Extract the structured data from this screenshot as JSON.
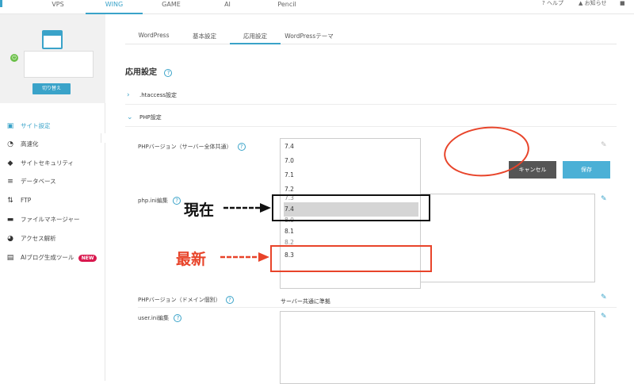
{
  "topnav": {
    "tabs": [
      "VPS",
      "WING",
      "GAME",
      "AI",
      "Pencil"
    ],
    "active_tab": "WING",
    "help_label": "ヘルプ",
    "notice_label": "お知らせ",
    "accent_color": "#3aa3c9"
  },
  "sidebar": {
    "switch_label": "切り替え",
    "items": [
      {
        "label": "サイト設定",
        "icon": "site-settings-icon",
        "active": true
      },
      {
        "label": "高速化",
        "icon": "speed-icon"
      },
      {
        "label": "サイトセキュリティ",
        "icon": "shield-icon"
      },
      {
        "label": "データベース",
        "icon": "database-icon"
      },
      {
        "label": "FTP",
        "icon": "transfer-icon"
      },
      {
        "label": "ファイルマネージャー",
        "icon": "folder-icon"
      },
      {
        "label": "アクセス解析",
        "icon": "pie-chart-icon"
      },
      {
        "label": "AIブログ生成ツール",
        "icon": "document-icon",
        "badge": "NEW"
      }
    ]
  },
  "subtabs": [
    "WordPress",
    "基本設定",
    "応用設定",
    "WordPressテーマ"
  ],
  "active_subtab": "応用設定",
  "page_title": "応用設定",
  "sections": {
    "htaccess": ".htaccess設定",
    "php": "PHP設定"
  },
  "fields": {
    "php_version_label": "PHPバージョン（サーバー全体共通）",
    "php_ini_label": "php.ini編集",
    "php_domain_label": "PHPバージョン（ドメイン個別）",
    "php_domain_value": "サーバー共通に準拠",
    "user_ini_label": "user.ini編集"
  },
  "php_dropdown": {
    "selected_value": "7.4",
    "options": [
      "7.4",
      "7.0",
      "7.1",
      "7.2",
      "7.3",
      "7.4",
      "8.0",
      "8.1",
      "8.2",
      "8.3"
    ]
  },
  "buttons": {
    "cancel": "キャンセル",
    "save": "保存"
  },
  "annotations": {
    "current": "現在",
    "latest": "最新",
    "current_color": "#111111",
    "latest_color": "#e8442a"
  }
}
